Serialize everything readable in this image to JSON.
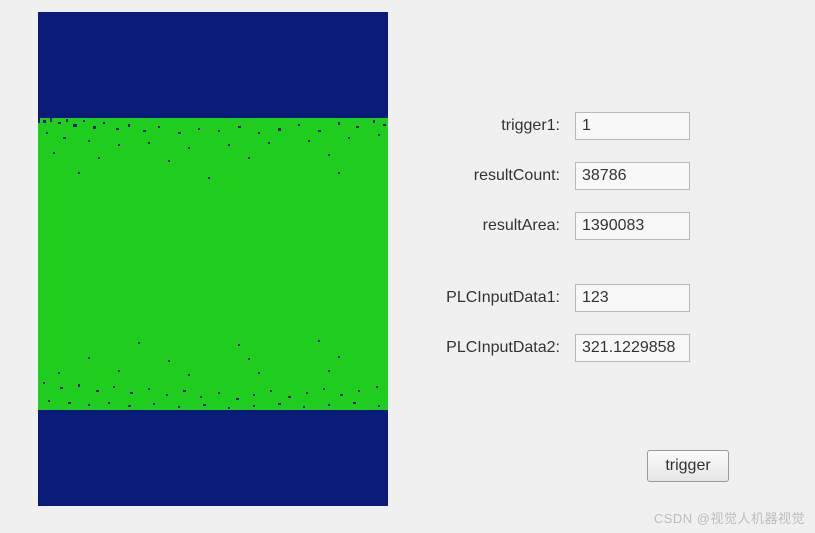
{
  "labels": {
    "trigger1": "trigger1:",
    "resultCount": "resultCount:",
    "resultArea": "resultArea:",
    "plcInputData1": "PLCInputData1:",
    "plcInputData2": "PLCInputData2:"
  },
  "values": {
    "trigger1": "1",
    "resultCount": "38786",
    "resultArea": "1390083",
    "plcInputData1": "123",
    "plcInputData2": "321.1229858"
  },
  "button": {
    "trigger": "trigger"
  },
  "watermark": "CSDN @视觉人机器视觉"
}
